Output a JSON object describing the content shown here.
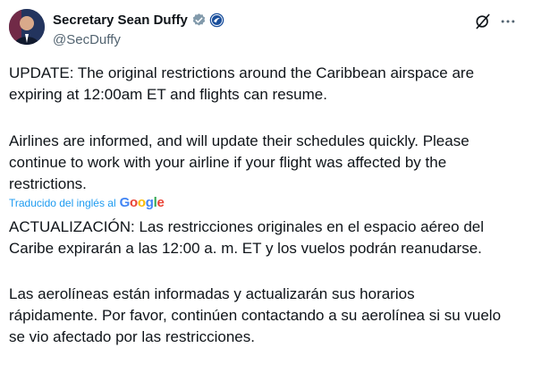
{
  "author": {
    "display_name": "Secretary Sean Duffy",
    "handle": "@SecDuffy",
    "avatar_icon": "avatar",
    "verified_color": "#829aab",
    "gov_badge_color": "#1a4f9c"
  },
  "post": {
    "paragraph_1": "UPDATE: The original restrictions around the Caribbean airspace are\nexpiring at 12:00am ET and flights can resume.",
    "paragraph_2": "Airlines are informed, and will update their schedules quickly. Please\ncontinue to work with your airline if your flight was affected by the\nrestrictions.",
    "translation_label": "Traducido del inglés al",
    "translation_brand": "Google",
    "translated_paragraph_1": "ACTUALIZACIÓN: Las restricciones originales en el espacio aéreo del\nCaribe expirarán a las 12:00 a. m. ET y los vuelos podrán reanudarse.",
    "translated_paragraph_2": "Las aerolíneas están informadas y actualizarán sus horarios\nrápidamente. Por favor, continúen contactando a su aerolínea si su vuelo\nse vio afectado por las restricciones."
  },
  "actions": {
    "grok_icon": "grok-icon",
    "more_icon": "more-icon"
  },
  "colors": {
    "text": "#0f1419",
    "secondary": "#536471",
    "link": "#1d9bf0"
  }
}
